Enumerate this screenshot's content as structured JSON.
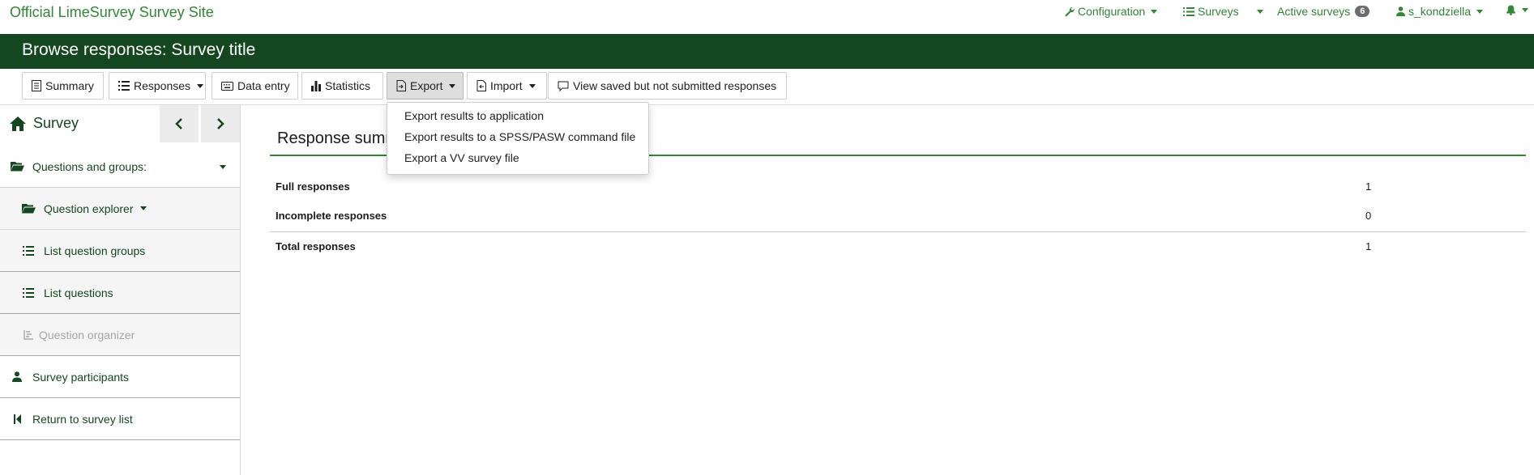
{
  "topnav": {
    "brand": "Official LimeSurvey Survey Site",
    "configuration": "Configuration",
    "surveys": "Surveys",
    "active_surveys": "Active surveys",
    "active_count": "6",
    "user": "s_kondziella"
  },
  "titlebar": {
    "title": "Browse responses: Survey title"
  },
  "toolbar": {
    "summary": "Summary",
    "responses": "Responses",
    "data_entry": "Data entry",
    "statistics": "Statistics",
    "export": "Export",
    "import": "Import",
    "view_saved": "View saved but not submitted responses"
  },
  "export_menu": {
    "items": [
      "Export results to application",
      "Export results to a SPSS/PASW command file",
      "Export a VV survey file"
    ]
  },
  "sidebar": {
    "title": "Survey",
    "questions_groups": "Questions and groups:",
    "question_explorer": "Question explorer",
    "list_question_groups": "List question groups",
    "list_questions": "List questions",
    "question_organizer": "Question organizer",
    "survey_participants": "Survey participants",
    "return_to_list": "Return to survey list"
  },
  "summary": {
    "title": "Response summ",
    "rows": [
      {
        "label": "Full responses",
        "value": "1"
      },
      {
        "label": "Incomplete responses",
        "value": "0"
      },
      {
        "label": "Total responses",
        "value": "1"
      }
    ]
  },
  "colors": {
    "brand_green": "#328637",
    "dark_green": "#14461f"
  }
}
